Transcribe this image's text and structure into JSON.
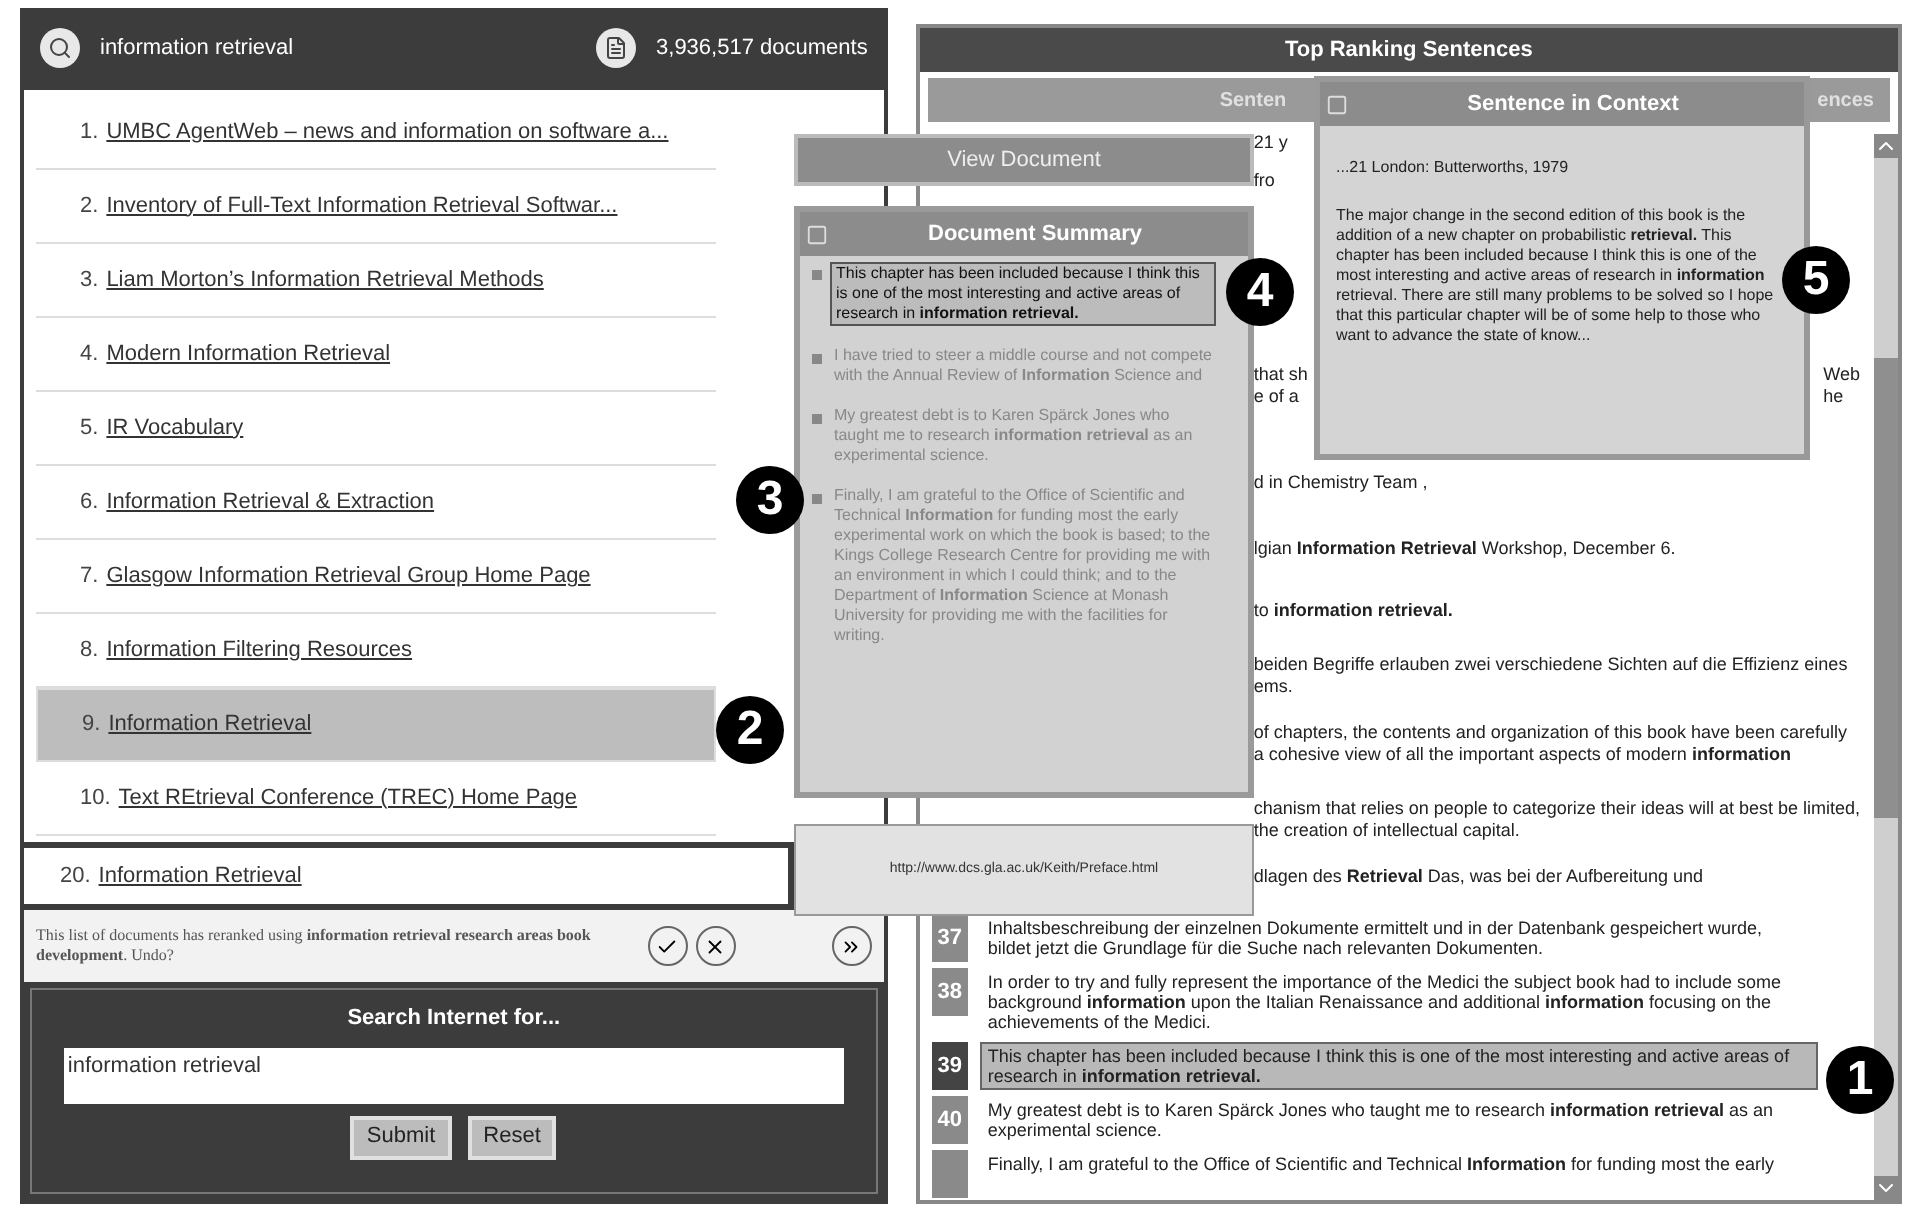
{
  "search_header": {
    "query": "information retrieval",
    "count": "3,936,517 documents"
  },
  "results": [
    {
      "number": "1.",
      "title": "UMBC AgentWeb – news and information on software a...",
      "selected": false
    },
    {
      "number": "2.",
      "title": "Inventory of Full-Text Information Retrieval Softwar...",
      "selected": false
    },
    {
      "number": "3.",
      "title": "Liam Morton’s Information Retrieval Methods",
      "selected": false
    },
    {
      "number": "4.",
      "title": "Modern Information Retrieval",
      "selected": false
    },
    {
      "number": "5.",
      "title": "IR Vocabulary",
      "selected": false
    },
    {
      "number": "6.",
      "title": "Information Retrieval & Extraction",
      "selected": false
    },
    {
      "number": "7.",
      "title": "Glasgow Information Retrieval Group Home Page",
      "selected": false
    },
    {
      "number": "8.",
      "title": "Information Filtering Resources",
      "selected": false
    },
    {
      "number": "9.",
      "title": "Information Retrieval",
      "selected": true
    },
    {
      "number": "10.",
      "title": "Text REtrieval Conference (TREC) Home Page",
      "selected": false
    }
  ],
  "extra_result": {
    "number": "20.",
    "title": "Information Retrieval"
  },
  "rerank_message": {
    "text": "This list of documents has reranked using **information retrieval research areas book development**. Undo?"
  },
  "search_panel": {
    "title": "Search Internet for...",
    "value": "information retrieval",
    "buttons": [
      "Submit",
      "Reset"
    ]
  },
  "view_document_button": "View Document",
  "document_summary": {
    "title": "Document Summary",
    "items": [
      {
        "text": "This chapter has been included because I think this is one of the most interesting and active areas of research in **information retrieval.**",
        "selected": true
      },
      {
        "text": "I have tried to steer a middle course and not compete with the Annual Review of **Information** Science and",
        "selected": false
      },
      {
        "text": "My greatest debt is to Karen Spärck Jones who taught me to research **information retrieval** as an experimental science.",
        "selected": false
      },
      {
        "text": "Finally, I am grateful to the Office of Scientific and Technical **Information** for funding most the early experimental work on which the book is based; to the Kings College Research Centre for providing me with an environment in which I could think; and to the Department of **Information** Science at Monash University for providing me with the facilities for writing.",
        "selected": false
      }
    ]
  },
  "url": "http://www.dcs.gla.ac.uk/Keith/Preface.html",
  "top_ranking": {
    "title": "Top Ranking Sentences",
    "tabs": [
      {
        "label": "Senten",
        "selected": false
      },
      {
        "label": "ences",
        "selected": false
      }
    ],
    "rows": [
      {
        "kind": "partial",
        "lines": [
          "21 y"
        ],
        "selected": false
      },
      {
        "kind": "partial",
        "lines": [
          "fro"
        ],
        "selected": false
      },
      {
        "kind": "partial",
        "lines": [
          "that sh",
          "e of a"
        ],
        "tail_lines": [
          "Web",
          "he"
        ],
        "selected": false
      },
      {
        "kind": "partial",
        "lines": [
          "d in Chemistry Team ,"
        ],
        "selected": false
      },
      {
        "kind": "partial",
        "lines": [
          "lgian **Information Retrieval** Workshop, December 6."
        ],
        "selected": false
      },
      {
        "kind": "partial",
        "lines": [
          "to **information retrieval.**"
        ],
        "selected": false
      },
      {
        "kind": "partial",
        "lines": [
          "beiden Begriffe erlauben zwei verschiedene Sichten auf die Effizienz eines",
          "ems."
        ],
        "selected": false
      },
      {
        "kind": "partial",
        "lines": [
          "of chapters, the contents and organization of this book have been carefully",
          "a cohesive view of all the important aspects of modern **information**"
        ],
        "selected": false
      },
      {
        "kind": "partial",
        "lines": [
          "chanism that relies on people to categorize their ideas will at best be limited,",
          "the creation of intellectual capital."
        ],
        "selected": false
      },
      {
        "kind": "partial",
        "lines": [
          "dlagen des **Retrieval** Das, was bei der Aufbereitung und"
        ],
        "selected": false
      },
      {
        "kind": "full",
        "number": "37",
        "text": "Inhaltsbeschreibung der einzelnen Dokumente ermittelt und in der Datenbank gespeichert wurde, bildet jetzt die Grundlage für die Suche nach relevanten Dokumenten.",
        "selected": false
      },
      {
        "kind": "full",
        "number": "38",
        "text": "In order to try and fully represent the importance of the Medici the subject book had to include some background **information** upon the Italian Renaissance and additional **information** focusing on the achievements of the Medici.",
        "selected": false
      },
      {
        "kind": "full",
        "number": "39",
        "text": "This chapter has been included because I think this is one of the most interesting and active areas of research in **information retrieval.**",
        "selected": true
      },
      {
        "kind": "full",
        "number": "40",
        "text": "My greatest debt is to Karen Spärck Jones who taught me to research **information retrieval** as an experimental science.",
        "selected": false
      },
      {
        "kind": "full",
        "text": "Finally, I am grateful to the Office of Scientific and Technical **Information** for funding most the early",
        "selected": false
      }
    ]
  },
  "sentence_in_context": {
    "title": "Sentence in Context",
    "paragraphs": [
      "...21 London: Butterworths, 1979",
      "The major change in the second edition of this book is the addition of a new chapter on probabilistic **retrieval.** This chapter has been included because I think this is one of the most interesting and active areas of research in **information** retrieval. There are still many problems to be solved so I hope that this particular chapter will be of some help to those who want to advance the state of know..."
    ]
  },
  "callouts": [
    "1",
    "2",
    "3",
    "4",
    "5"
  ]
}
